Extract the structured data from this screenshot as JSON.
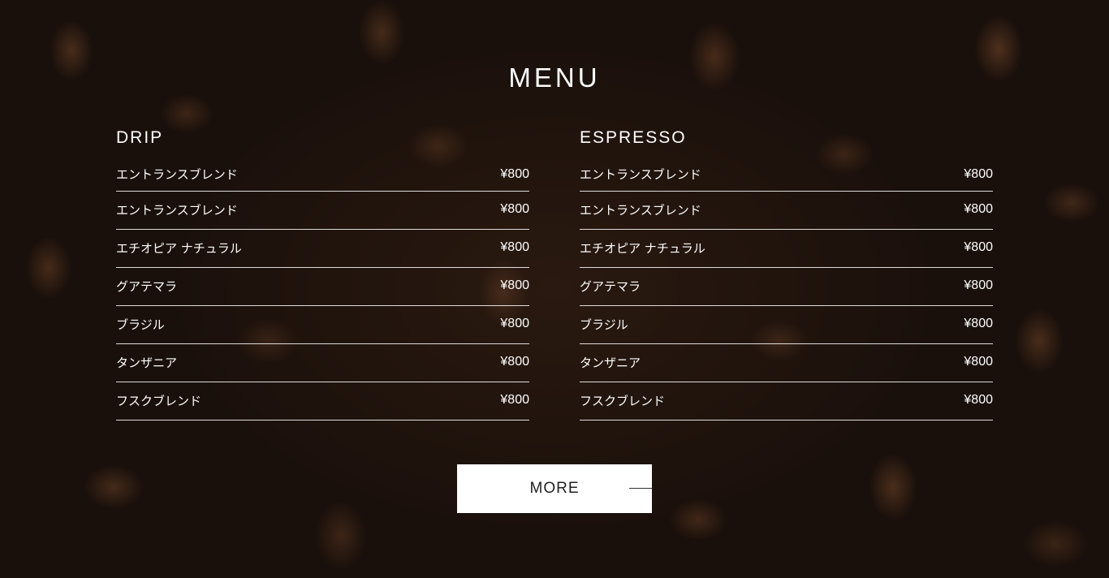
{
  "title": "MENU",
  "sections": [
    {
      "heading": "DRIP",
      "items": [
        {
          "name": "エントランスブレンド",
          "price": "¥800"
        },
        {
          "name": "エントランスブレンド",
          "price": "¥800"
        },
        {
          "name": "エチオピア ナチュラル",
          "price": "¥800"
        },
        {
          "name": "グアテマラ",
          "price": "¥800"
        },
        {
          "name": "ブラジル",
          "price": "¥800"
        },
        {
          "name": "タンザニア",
          "price": "¥800"
        },
        {
          "name": "フスクブレンド",
          "price": "¥800"
        }
      ]
    },
    {
      "heading": "ESPRESSO",
      "items": [
        {
          "name": "エントランスブレンド",
          "price": "¥800"
        },
        {
          "name": "エントランスブレンド",
          "price": "¥800"
        },
        {
          "name": "エチオピア ナチュラル",
          "price": "¥800"
        },
        {
          "name": "グアテマラ",
          "price": "¥800"
        },
        {
          "name": "ブラジル",
          "price": "¥800"
        },
        {
          "name": "タンザニア",
          "price": "¥800"
        },
        {
          "name": "フスクブレンド",
          "price": "¥800"
        }
      ]
    }
  ],
  "more_button": {
    "label": "MORE"
  },
  "colors": {
    "text": "#ffffff",
    "background": "#1a100b",
    "button": "#ffffff"
  }
}
